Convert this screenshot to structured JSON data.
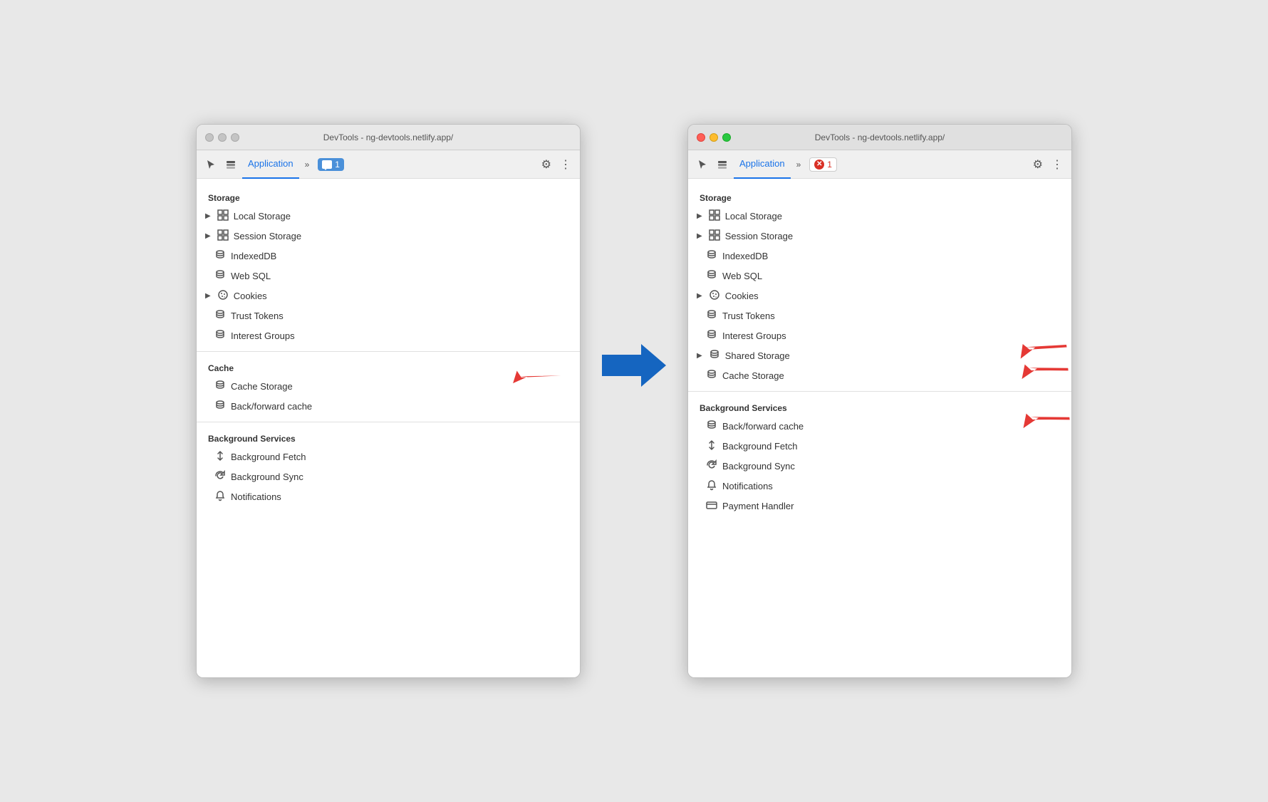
{
  "window1": {
    "title": "DevTools - ng-devtools.netlify.app/",
    "tab": "Application",
    "badge_label": "1",
    "badge_type": "chat",
    "storage_header": "Storage",
    "cache_header": "Cache",
    "background_header": "Background Services",
    "items": {
      "local_storage": "Local Storage",
      "session_storage": "Session Storage",
      "indexeddb": "IndexedDB",
      "web_sql": "Web SQL",
      "cookies": "Cookies",
      "trust_tokens": "Trust Tokens",
      "interest_groups": "Interest Groups",
      "cache_storage": "Cache Storage",
      "backforward_cache": "Back/forward cache",
      "background_fetch": "Background Fetch",
      "background_sync": "Background Sync",
      "notifications": "Notifications"
    }
  },
  "window2": {
    "title": "DevTools - ng-devtools.netlify.app/",
    "tab": "Application",
    "badge_label": "1",
    "badge_type": "error",
    "storage_header": "Storage",
    "background_header": "Background Services",
    "items": {
      "local_storage": "Local Storage",
      "session_storage": "Session Storage",
      "indexeddb": "IndexedDB",
      "web_sql": "Web SQL",
      "cookies": "Cookies",
      "trust_tokens": "Trust Tokens",
      "interest_groups": "Interest Groups",
      "shared_storage": "Shared Storage",
      "cache_storage": "Cache Storage",
      "backforward_cache": "Back/forward cache",
      "background_fetch": "Background Fetch",
      "background_sync": "Background Sync",
      "notifications": "Notifications",
      "payment_handler": "Payment Handler"
    }
  },
  "icons": {
    "cursor": "↖",
    "layers": "⧉",
    "chevron_right": "▶",
    "chevron_down": "▼",
    "more": "»",
    "gear": "⚙",
    "dots": "⋮",
    "database": "🗄",
    "cookie": "🍪",
    "grid": "▦",
    "chat_icon": "💬",
    "error_x": "✕",
    "arrow_updown": "↕",
    "sync": "↺",
    "bell": "🔔"
  }
}
